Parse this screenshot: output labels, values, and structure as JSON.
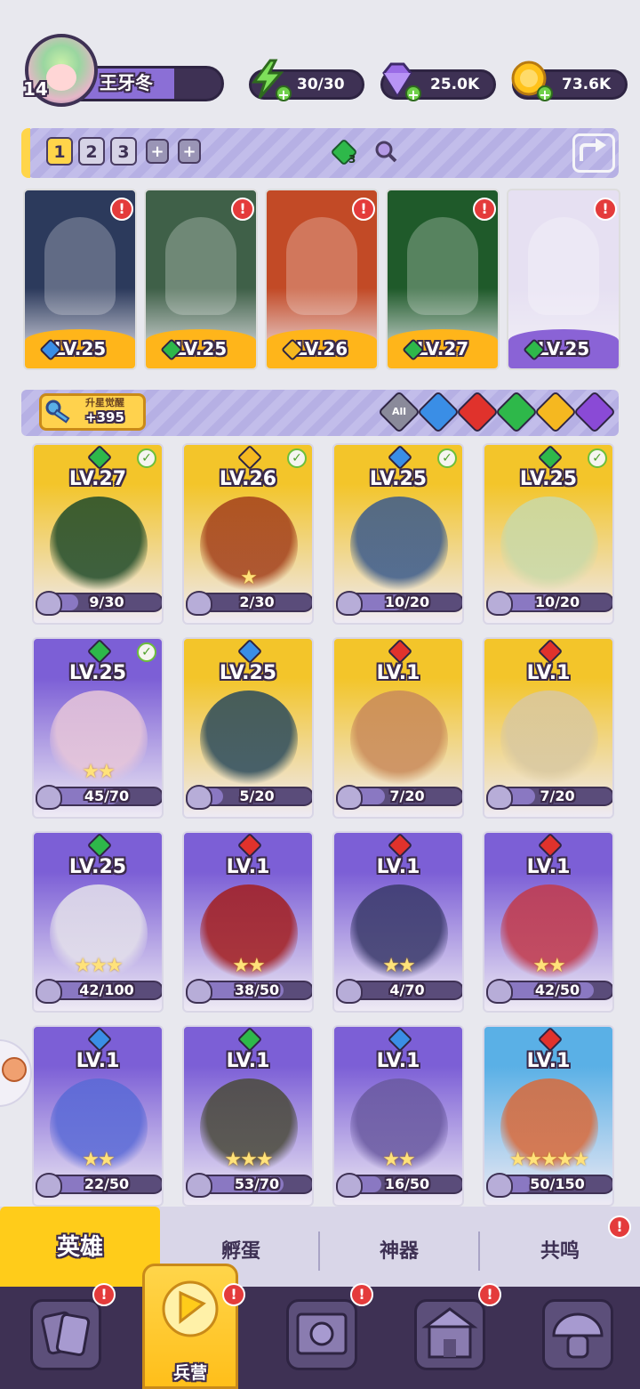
{
  "player": {
    "level": "14",
    "name": "王牙冬"
  },
  "resources": {
    "energy": "30/30",
    "gems": "25.0K",
    "coins": "73.6K",
    "energy_icon": "lightning-icon",
    "gem_icon": "gem-icon",
    "coin_icon": "coin-icon"
  },
  "team_tabs": {
    "numbers": [
      "1",
      "2",
      "3"
    ],
    "plus": [
      "+",
      "+"
    ],
    "element_count": "3",
    "share_icon": "share-icon"
  },
  "team": [
    {
      "level": "LV.25",
      "element": "water",
      "color_top": "#2c3a5c",
      "color_bottom": "#ffb51a"
    },
    {
      "level": "LV.25",
      "element": "wind",
      "color_top": "#3f6048",
      "color_bottom": "#ffb51a"
    },
    {
      "level": "LV.26",
      "element": "light",
      "color_top": "#c24a26",
      "color_bottom": "#ffb51a"
    },
    {
      "level": "LV.27",
      "element": "wind",
      "color_top": "#1f5a2a",
      "color_bottom": "#ffb51a"
    },
    {
      "level": "LV.25",
      "element": "wind",
      "color_top": "#e6e0f2",
      "color_bottom": "#8a63d6"
    }
  ],
  "filter": {
    "awaken_label": "升星觉醒",
    "awaken_value": "+395",
    "all_label": "All",
    "elements": [
      "water",
      "fire",
      "wind",
      "light",
      "dark"
    ]
  },
  "heroes": [
    {
      "level": "LV.27",
      "element": "wind",
      "checked": true,
      "shards": "9/30",
      "fill": 0.3,
      "stars": "",
      "frame": "gold",
      "art": "#1e4a2a"
    },
    {
      "level": "LV.26",
      "element": "light",
      "checked": true,
      "shards": "2/30",
      "fill": 0.07,
      "stars": "★",
      "frame": "gold",
      "art": "#a3401c"
    },
    {
      "level": "LV.25",
      "element": "water",
      "checked": true,
      "shards": "10/20",
      "fill": 0.5,
      "stars": "",
      "frame": "gold",
      "art": "#3a5a8c"
    },
    {
      "level": "LV.25",
      "element": "wind",
      "checked": true,
      "shards": "10/20",
      "fill": 0.5,
      "stars": "",
      "frame": "gold",
      "art": "#c9d9a8"
    },
    {
      "level": "LV.25",
      "element": "wind",
      "checked": true,
      "shards": "45/70",
      "fill": 0.64,
      "stars": "★★",
      "frame": "purple",
      "art": "#e7c6d9"
    },
    {
      "level": "LV.25",
      "element": "water",
      "checked": false,
      "shards": "5/20",
      "fill": 0.25,
      "stars": "",
      "frame": "gold",
      "art": "#2a4a5c"
    },
    {
      "level": "LV.1",
      "element": "fire",
      "checked": false,
      "shards": "7/20",
      "fill": 0.35,
      "stars": "",
      "frame": "gold",
      "art": "#c98a5a"
    },
    {
      "level": "LV.1",
      "element": "fire",
      "checked": false,
      "shards": "7/20",
      "fill": 0.35,
      "stars": "",
      "frame": "gold",
      "art": "#d9c8a0"
    },
    {
      "level": "LV.25",
      "element": "wind",
      "checked": false,
      "shards": "42/100",
      "fill": 0.42,
      "stars": "★★★",
      "frame": "purple",
      "art": "#e4e1ea"
    },
    {
      "level": "LV.1",
      "element": "fire",
      "checked": false,
      "shards": "38/50",
      "fill": 0.76,
      "stars": "★★",
      "frame": "purple",
      "art": "#a31e1e"
    },
    {
      "level": "LV.1",
      "element": "fire",
      "checked": false,
      "shards": "4/70",
      "fill": 0.06,
      "stars": "★★",
      "frame": "purple",
      "art": "#3a3a6a"
    },
    {
      "level": "LV.1",
      "element": "fire",
      "checked": false,
      "shards": "42/50",
      "fill": 0.84,
      "stars": "★★",
      "frame": "purple",
      "art": "#c23a4a"
    },
    {
      "level": "LV.1",
      "element": "water",
      "checked": false,
      "shards": "22/50",
      "fill": 0.44,
      "stars": "★★",
      "frame": "purple",
      "art": "#5a6ad6"
    },
    {
      "level": "LV.1",
      "element": "wind",
      "checked": false,
      "shards": "53/70",
      "fill": 0.76,
      "stars": "★★★",
      "frame": "purple",
      "art": "#4a4a3a"
    },
    {
      "level": "LV.1",
      "element": "water",
      "checked": false,
      "shards": "16/50",
      "fill": 0.32,
      "stars": "★★",
      "frame": "purple",
      "art": "#6a5aa0"
    },
    {
      "level": "LV.1",
      "element": "fire",
      "checked": false,
      "shards": "50/150",
      "fill": 0.33,
      "stars": "★★★★★",
      "frame": "blue",
      "art": "#d96a3a"
    }
  ],
  "tabs": {
    "heroes": "英雄",
    "hatch": "孵蛋",
    "artifact": "神器",
    "resonance": "共鸣"
  },
  "nav": {
    "barracks": "兵营",
    "cards_icon": "cards-icon",
    "map_icon": "map-icon",
    "castle_icon": "castle-icon",
    "mushroom_icon": "mushroom-icon"
  },
  "alert_mark": "!",
  "check_mark": "✓",
  "colors": {
    "water": "#3a8ee6",
    "fire": "#e0322c",
    "wind": "#2eb84a",
    "light": "#f5b820",
    "dark": "#8a4ad6",
    "gold_frame": "#f3c52a",
    "purple_frame": "#7c5fd6",
    "blue_frame": "#5ab0e6"
  }
}
